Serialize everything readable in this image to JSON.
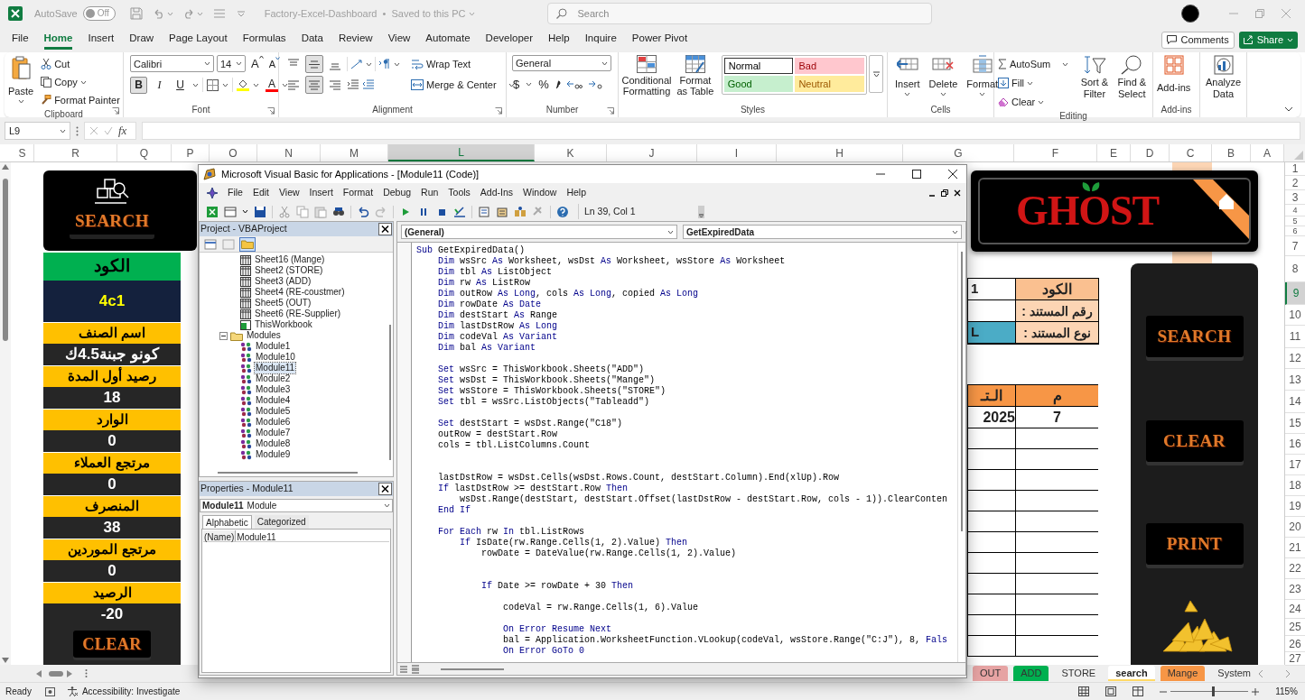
{
  "title_bar": {
    "autosave_label": "AutoSave",
    "autosave_on": false,
    "autosave_state": "Off",
    "file_title": "Factory-Excel-Dashboard  •  Saved to this PC",
    "search_placeholder": "Search"
  },
  "ribbon_tabs": [
    {
      "label": "File",
      "selected": false
    },
    {
      "label": "Home",
      "selected": true
    },
    {
      "label": "Insert",
      "selected": false
    },
    {
      "label": "Draw",
      "selected": false
    },
    {
      "label": "Page Layout",
      "selected": false
    },
    {
      "label": "Formulas",
      "selected": false
    },
    {
      "label": "Data",
      "selected": false
    },
    {
      "label": "Review",
      "selected": false
    },
    {
      "label": "View",
      "selected": false
    },
    {
      "label": "Automate",
      "selected": false
    },
    {
      "label": "Developer",
      "selected": false
    },
    {
      "label": "Help",
      "selected": false
    },
    {
      "label": "Inquire",
      "selected": false
    },
    {
      "label": "Power Pivot",
      "selected": false
    }
  ],
  "comments_button": "Comments",
  "share_button": "Share",
  "ribbon": {
    "clipboard": {
      "paste": "Paste",
      "cut": "Cut",
      "copy": "Copy",
      "format_painter": "Format Painter",
      "label": "Clipboard"
    },
    "font": {
      "name": "Calibri",
      "size": "14",
      "grow": "A",
      "shrink": "A",
      "styles": [
        {
          "label": "B",
          "pressed": true
        },
        {
          "label": "I",
          "pressed": false
        },
        {
          "label": "U",
          "pressed": false
        }
      ],
      "font_color": "A",
      "label": "Font"
    },
    "alignment": {
      "buttons": [
        {
          "kind": "top",
          "pressed": false
        },
        {
          "kind": "middle",
          "pressed": true
        },
        {
          "kind": "bottom",
          "pressed": false
        },
        {
          "kind": "left",
          "pressed": false
        },
        {
          "kind": "center",
          "pressed": true
        },
        {
          "kind": "right",
          "pressed": false
        }
      ],
      "wrap_text": "Wrap Text",
      "merge_center": "Merge & Center",
      "label": "Alignment"
    },
    "number": {
      "format": "General",
      "symbols": [
        "$",
        "%"
      ],
      "label": "Number"
    },
    "styles": {
      "conditional_formatting": "Conditional Formatting",
      "format_as_table": "Format as Table",
      "cell_styles": [
        {
          "label": "Normal",
          "color": "#ffffff"
        },
        {
          "label": "Bad",
          "color": "#ffc7ce"
        },
        {
          "label": "Good",
          "color": "#c6efce"
        },
        {
          "label": "Neutral",
          "color": "#ffeb9c"
        }
      ],
      "label": "Styles"
    },
    "cells": {
      "buttons": [
        "Insert",
        "Delete",
        "Format"
      ],
      "label": "Cells"
    },
    "editing": {
      "autosum": "AutoSum",
      "fill": "Fill",
      "clear": "Clear",
      "sort_filter": "Sort & Filter",
      "find_select": "Find & Select",
      "label": "Editing"
    },
    "add_ins": {
      "button": "Add-ins",
      "label": "Add-ins"
    },
    "analyze": {
      "button": "Analyze Data"
    }
  },
  "formula_bar": {
    "name_box": "L9",
    "function_label": "fx"
  },
  "column_headers": [
    {
      "label": "S",
      "selected": false
    },
    {
      "label": "R",
      "selected": false
    },
    {
      "label": "Q",
      "selected": false
    },
    {
      "label": "P",
      "selected": false
    },
    {
      "label": "O",
      "selected": false
    },
    {
      "label": "N",
      "selected": false
    },
    {
      "label": "M",
      "selected": false
    },
    {
      "label": "L",
      "selected": true
    },
    {
      "label": "K",
      "selected": false
    },
    {
      "label": "J",
      "selected": false
    },
    {
      "label": "I",
      "selected": false
    },
    {
      "label": "H",
      "selected": false
    },
    {
      "label": "G",
      "selected": false
    },
    {
      "label": "F",
      "selected": false
    },
    {
      "label": "E",
      "selected": false
    },
    {
      "label": "D",
      "selected": false
    },
    {
      "label": "C",
      "selected": false
    },
    {
      "label": "B",
      "selected": false
    },
    {
      "label": "A",
      "selected": false
    }
  ],
  "row_headers": [
    {
      "label": "1",
      "selected": false
    },
    {
      "label": "2",
      "selected": false
    },
    {
      "label": "3",
      "selected": false
    },
    {
      "label": "4",
      "selected": false
    },
    {
      "label": "5",
      "selected": false
    },
    {
      "label": "6",
      "selected": false
    },
    {
      "label": "7",
      "selected": false
    },
    {
      "label": "8",
      "selected": false
    },
    {
      "label": "9",
      "selected": true
    },
    {
      "label": "10",
      "selected": false
    },
    {
      "label": "11",
      "selected": false
    },
    {
      "label": "12",
      "selected": false
    },
    {
      "label": "13",
      "selected": false
    },
    {
      "label": "14",
      "selected": false
    },
    {
      "label": "15",
      "selected": false
    },
    {
      "label": "16",
      "selected": false
    },
    {
      "label": "17",
      "selected": false
    },
    {
      "label": "18",
      "selected": false
    },
    {
      "label": "19",
      "selected": false
    },
    {
      "label": "20",
      "selected": false
    },
    {
      "label": "21",
      "selected": false
    },
    {
      "label": "22",
      "selected": false
    },
    {
      "label": "23",
      "selected": false
    },
    {
      "label": "24",
      "selected": false
    },
    {
      "label": "25",
      "selected": false
    },
    {
      "label": "26",
      "selected": false
    },
    {
      "label": "27",
      "selected": false
    }
  ],
  "left_panel": {
    "search_button": "SEARCH",
    "code": {
      "label": "الكود",
      "value": "4c1"
    },
    "fields": [
      {
        "label": "اسم الصنف",
        "value": "كونو جبنة4.5ك"
      },
      {
        "label": "رصيد أول المدة",
        "value": "18"
      },
      {
        "label": "الوارد",
        "value": "0"
      },
      {
        "label": "مرتجع العملاء",
        "value": "0"
      },
      {
        "label": "المنصرف",
        "value": "38"
      },
      {
        "label": "مرتجع الموردين",
        "value": "0"
      },
      {
        "label": "الرصيد",
        "value": "-20"
      }
    ],
    "clear_button": "CLEAR"
  },
  "logo": {
    "text": "GHOST"
  },
  "form": [
    {
      "label": "الكود",
      "value": "1",
      "kind": "header"
    },
    {
      "label": "رقم المستند :",
      "kind": "plain"
    },
    {
      "label": "نوع المستند :",
      "value": "L",
      "kind": "highlight"
    }
  ],
  "table": {
    "columns": [
      "الـتـ",
      "م"
    ],
    "rows": [
      [
        "2025",
        "7"
      ]
    ]
  },
  "right_panel": {
    "buttons": [
      "SEARCH",
      "CLEAR",
      "PRINT"
    ]
  },
  "vba": {
    "title": "Microsoft Visual Basic for Applications - [Module11 (Code)]",
    "menus": [
      "File",
      "Edit",
      "View",
      "Insert",
      "Format",
      "Debug",
      "Run",
      "Tools",
      "Add-Ins",
      "Window",
      "Help"
    ],
    "position": "Ln 39, Col 1",
    "project": {
      "title": "Project - VBAProject",
      "tree": [
        {
          "label": "Sheet16 (Mange)",
          "kind": "sheet",
          "selected": false
        },
        {
          "label": "Sheet2 (STORE)",
          "kind": "sheet",
          "selected": false
        },
        {
          "label": "Sheet3 (ADD)",
          "kind": "sheet",
          "selected": false
        },
        {
          "label": "Sheet4 (RE-coustmer)",
          "kind": "sheet",
          "selected": false
        },
        {
          "label": "Sheet5 (OUT)",
          "kind": "sheet",
          "selected": false
        },
        {
          "label": "Sheet6 (RE-Supplier)",
          "kind": "sheet",
          "selected": false
        },
        {
          "label": "ThisWorkbook",
          "kind": "workbook",
          "selected": false
        },
        {
          "label": "Modules",
          "kind": "folder",
          "selected": false,
          "expanded": true,
          "children": [
            {
              "label": "Module1",
              "kind": "module",
              "selected": false
            },
            {
              "label": "Module10",
              "kind": "module",
              "selected": false
            },
            {
              "label": "Module11",
              "kind": "module",
              "selected": true
            },
            {
              "label": "Module2",
              "kind": "module",
              "selected": false
            },
            {
              "label": "Module3",
              "kind": "module",
              "selected": false
            },
            {
              "label": "Module4",
              "kind": "module",
              "selected": false
            },
            {
              "label": "Module5",
              "kind": "module",
              "selected": false
            },
            {
              "label": "Module6",
              "kind": "module",
              "selected": false
            },
            {
              "label": "Module7",
              "kind": "module",
              "selected": false
            },
            {
              "label": "Module8",
              "kind": "module",
              "selected": false
            },
            {
              "label": "Module9",
              "kind": "module",
              "selected": false
            }
          ]
        }
      ]
    },
    "properties": {
      "title": "Properties - Module11",
      "object_name": "Module11",
      "object_type": "Module",
      "tabs": [
        {
          "label": "Alphabetic",
          "selected": true
        },
        {
          "label": "Categorized",
          "selected": false
        }
      ],
      "rows": [
        {
          "name": "(Name)",
          "value": "Module11"
        }
      ]
    },
    "object_dropdown": "(General)",
    "procedure_dropdown": "GetExpiredData",
    "code": [
      {
        "kind": "code",
        "tokens": [
          {
            "kind": "keyword",
            "text": "Sub"
          },
          {
            "kind": "plain",
            "text": " GetExpiredData()"
          }
        ]
      },
      {
        "kind": "code",
        "tokens": [
          {
            "kind": "keyword",
            "text": "    Dim"
          },
          {
            "kind": "plain",
            "text": " wsSrc "
          },
          {
            "kind": "keyword",
            "text": "As"
          },
          {
            "kind": "plain",
            "text": " Worksheet, wsDst "
          },
          {
            "kind": "keyword",
            "text": "As"
          },
          {
            "kind": "plain",
            "text": " Worksheet, wsStore "
          },
          {
            "kind": "keyword",
            "text": "As"
          },
          {
            "kind": "plain",
            "text": " Worksheet"
          }
        ]
      },
      {
        "kind": "code",
        "tokens": [
          {
            "kind": "keyword",
            "text": "    Dim"
          },
          {
            "kind": "plain",
            "text": " tbl "
          },
          {
            "kind": "keyword",
            "text": "As"
          },
          {
            "kind": "plain",
            "text": " ListObject"
          }
        ]
      },
      {
        "kind": "code",
        "tokens": [
          {
            "kind": "keyword",
            "text": "    Dim"
          },
          {
            "kind": "plain",
            "text": " rw "
          },
          {
            "kind": "keyword",
            "text": "As"
          },
          {
            "kind": "plain",
            "text": " ListRow"
          }
        ]
      },
      {
        "kind": "code",
        "tokens": [
          {
            "kind": "keyword",
            "text": "    Dim"
          },
          {
            "kind": "plain",
            "text": " outRow "
          },
          {
            "kind": "keyword",
            "text": "As Long"
          },
          {
            "kind": "plain",
            "text": ", cols "
          },
          {
            "kind": "keyword",
            "text": "As Long"
          },
          {
            "kind": "plain",
            "text": ", copied "
          },
          {
            "kind": "keyword",
            "text": "As Long"
          }
        ]
      },
      {
        "kind": "code",
        "tokens": [
          {
            "kind": "keyword",
            "text": "    Dim"
          },
          {
            "kind": "plain",
            "text": " rowDate "
          },
          {
            "kind": "keyword",
            "text": "As Date"
          }
        ]
      },
      {
        "kind": "code",
        "tokens": [
          {
            "kind": "keyword",
            "text": "    Dim"
          },
          {
            "kind": "plain",
            "text": " destStart "
          },
          {
            "kind": "keyword",
            "text": "As"
          },
          {
            "kind": "plain",
            "text": " Range"
          }
        ]
      },
      {
        "kind": "code",
        "tokens": [
          {
            "kind": "keyword",
            "text": "    Dim"
          },
          {
            "kind": "plain",
            "text": " lastDstRow "
          },
          {
            "kind": "keyword",
            "text": "As Long"
          }
        ]
      },
      {
        "kind": "code",
        "tokens": [
          {
            "kind": "keyword",
            "text": "    Dim"
          },
          {
            "kind": "plain",
            "text": " codeVal "
          },
          {
            "kind": "keyword",
            "text": "As Variant"
          }
        ]
      },
      {
        "kind": "code",
        "tokens": [
          {
            "kind": "keyword",
            "text": "    Dim"
          },
          {
            "kind": "plain",
            "text": " bal "
          },
          {
            "kind": "keyword",
            "text": "As Variant"
          }
        ]
      },
      {
        "kind": "blank"
      },
      {
        "kind": "code",
        "tokens": [
          {
            "kind": "keyword",
            "text": "    Set"
          },
          {
            "kind": "plain",
            "text": " wsSrc = ThisWorkbook.Sheets(\"ADD\")"
          }
        ]
      },
      {
        "kind": "code",
        "tokens": [
          {
            "kind": "keyword",
            "text": "    Set"
          },
          {
            "kind": "plain",
            "text": " wsDst = ThisWorkbook.Sheets(\"Mange\")"
          }
        ]
      },
      {
        "kind": "code",
        "tokens": [
          {
            "kind": "keyword",
            "text": "    Set"
          },
          {
            "kind": "plain",
            "text": " wsStore = ThisWorkbook.Sheets(\"STORE\")"
          }
        ]
      },
      {
        "kind": "code",
        "tokens": [
          {
            "kind": "keyword",
            "text": "    Set"
          },
          {
            "kind": "plain",
            "text": " tbl = wsSrc.ListObjects(\"Tableadd\")"
          }
        ]
      },
      {
        "kind": "blank"
      },
      {
        "kind": "code",
        "tokens": [
          {
            "kind": "keyword",
            "text": "    Set"
          },
          {
            "kind": "plain",
            "text": " destStart = wsDst.Range(\"C18\")"
          }
        ]
      },
      {
        "kind": "code",
        "tokens": [
          {
            "kind": "plain",
            "text": "    outRow = destStart.Row"
          }
        ]
      },
      {
        "kind": "code",
        "tokens": [
          {
            "kind": "plain",
            "text": "    cols = tbl.ListColumns.Count"
          }
        ]
      },
      {
        "kind": "blank"
      },
      {
        "kind": "blank"
      },
      {
        "kind": "code",
        "tokens": [
          {
            "kind": "plain",
            "text": "    lastDstRow = wsDst.Cells(wsDst.Rows.Count, destStart.Column).End(xlUp).Row"
          }
        ]
      },
      {
        "kind": "code",
        "tokens": [
          {
            "kind": "keyword",
            "text": "    If"
          },
          {
            "kind": "plain",
            "text": " lastDstRow >= destStart.Row "
          },
          {
            "kind": "keyword",
            "text": "Then"
          }
        ]
      },
      {
        "kind": "code",
        "tokens": [
          {
            "kind": "plain",
            "text": "        wsDst.Range(destStart, destStart.Offset(lastDstRow - destStart.Row, cols - 1)).ClearConten"
          }
        ]
      },
      {
        "kind": "code",
        "tokens": [
          {
            "kind": "keyword",
            "text": "    End If"
          }
        ]
      },
      {
        "kind": "blank"
      },
      {
        "kind": "code",
        "tokens": [
          {
            "kind": "keyword",
            "text": "    For Each"
          },
          {
            "kind": "plain",
            "text": " rw "
          },
          {
            "kind": "keyword",
            "text": "In"
          },
          {
            "kind": "plain",
            "text": " tbl.ListRows"
          }
        ]
      },
      {
        "kind": "code",
        "tokens": [
          {
            "kind": "keyword",
            "text": "        If"
          },
          {
            "kind": "plain",
            "text": " IsDate(rw.Range.Cells(1, 2).Value) "
          },
          {
            "kind": "keyword",
            "text": "Then"
          }
        ]
      },
      {
        "kind": "code",
        "tokens": [
          {
            "kind": "plain",
            "text": "            rowDate = DateValue(rw.Range.Cells(1, 2).Value)"
          }
        ]
      },
      {
        "kind": "blank"
      },
      {
        "kind": "blank"
      },
      {
        "kind": "code",
        "tokens": [
          {
            "kind": "keyword",
            "text": "            If"
          },
          {
            "kind": "plain",
            "text": " Date >= rowDate + 30 "
          },
          {
            "kind": "keyword",
            "text": "Then"
          }
        ]
      },
      {
        "kind": "blank"
      },
      {
        "kind": "code",
        "tokens": [
          {
            "kind": "plain",
            "text": "                codeVal = rw.Range.Cells(1, 6).Value"
          }
        ]
      },
      {
        "kind": "blank"
      },
      {
        "kind": "code",
        "tokens": [
          {
            "kind": "keyword",
            "text": "                On Error Resume Next"
          }
        ]
      },
      {
        "kind": "code",
        "tokens": [
          {
            "kind": "plain",
            "text": "                bal = Application.WorksheetFunction.VLookup(codeVal, wsStore.Range(\"C:J\"), 8, "
          },
          {
            "kind": "keyword",
            "text": "Fals"
          }
        ]
      },
      {
        "kind": "code",
        "tokens": [
          {
            "kind": "keyword",
            "text": "                On Error GoTo 0"
          }
        ]
      }
    ]
  },
  "sheet_tabs": [
    {
      "label": "OUT",
      "color": "#e6a3a3",
      "selected": false
    },
    {
      "label": "ADD",
      "color": "#00b050",
      "selected": false
    },
    {
      "label": "STORE",
      "selected": false
    },
    {
      "label": "search",
      "selected": true
    },
    {
      "label": "Mange",
      "color": "#f79646",
      "selected": false
    },
    {
      "label": "System",
      "selected": false
    }
  ],
  "status_bar": {
    "ready": "Ready",
    "accessibility": "Accessibility: Investigate",
    "zoom": {
      "level": 0.55,
      "reading": "115%"
    }
  }
}
